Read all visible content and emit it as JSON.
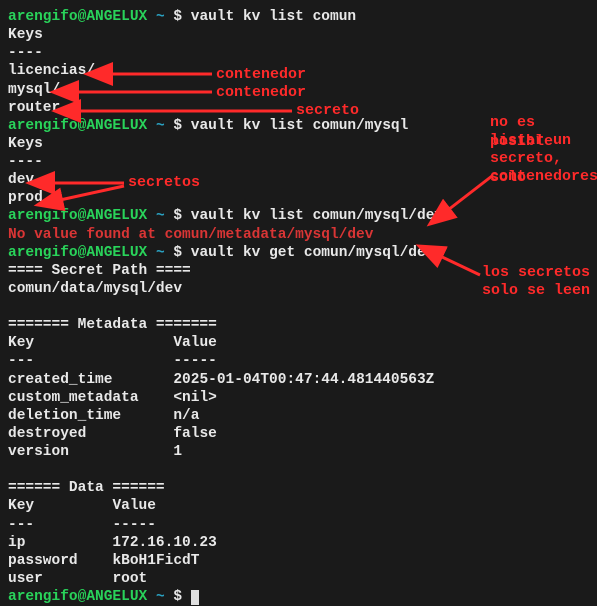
{
  "prompt_user": "arengifo",
  "prompt_host": "ANGELUX",
  "prompt_path": "~",
  "prompt_symbol": "$",
  "cmd1": "vault kv list comun",
  "out1_header": "Keys",
  "out1_sep": "----",
  "out1_items": {
    "i0": "licencias/",
    "i1": "mysql/",
    "i2": "router"
  },
  "cmd2": "vault kv list comun/mysql",
  "out2_header": "Keys",
  "out2_sep": "----",
  "out2_items": {
    "i0": "dev",
    "i1": "prod"
  },
  "cmd3": "vault kv list comun/mysql/dev",
  "err3": "No value found at comun/metadata/mysql/dev",
  "cmd4": "vault kv get comun/mysql/dev",
  "secret_path_hdr": "==== Secret Path ====",
  "secret_path_val": "comun/data/mysql/dev",
  "metadata_hdr": "======= Metadata =======",
  "meta_key_lbl": "Key",
  "meta_val_lbl": "Value",
  "meta_key_sep": "---",
  "meta_val_sep": "-----",
  "meta": {
    "created_time": {
      "k": "created_time",
      "v": "2025-01-04T00:47:44.481440563Z"
    },
    "custom_metadata": {
      "k": "custom_metadata",
      "v": "<nil>"
    },
    "deletion_time": {
      "k": "deletion_time",
      "v": "n/a"
    },
    "destroyed": {
      "k": "destroyed",
      "v": "false"
    },
    "version": {
      "k": "version",
      "v": "1"
    }
  },
  "data_hdr": "====== Data ======",
  "data_key_lbl": "Key",
  "data_val_lbl": "Value",
  "data_key_sep": "---",
  "data_val_sep": "-----",
  "data": {
    "ip": {
      "k": "ip",
      "v": "172.16.10.23"
    },
    "password": {
      "k": "password",
      "v": "kBoH1FicdT"
    },
    "user": {
      "k": "user",
      "v": "root"
    }
  },
  "annotations": {
    "contenedor1": "contenedor",
    "contenedor2": "contenedor",
    "secreto": "secreto",
    "secretos": "secretos",
    "no_listar_1": "no es posible",
    "no_listar_2": "listar un",
    "no_listar_3": "secreto, solo",
    "no_listar_4": "contenedores",
    "solo_leen_1": "los secretos",
    "solo_leen_2": "solo se leen"
  },
  "chart_data": {
    "type": "table",
    "metadata_rows": [
      [
        "created_time",
        "2025-01-04T00:47:44.481440563Z"
      ],
      [
        "custom_metadata",
        "<nil>"
      ],
      [
        "deletion_time",
        "n/a"
      ],
      [
        "destroyed",
        "false"
      ],
      [
        "version",
        "1"
      ]
    ],
    "data_rows": [
      [
        "ip",
        "172.16.10.23"
      ],
      [
        "password",
        "kBoH1FicdT"
      ],
      [
        "user",
        "root"
      ]
    ]
  }
}
